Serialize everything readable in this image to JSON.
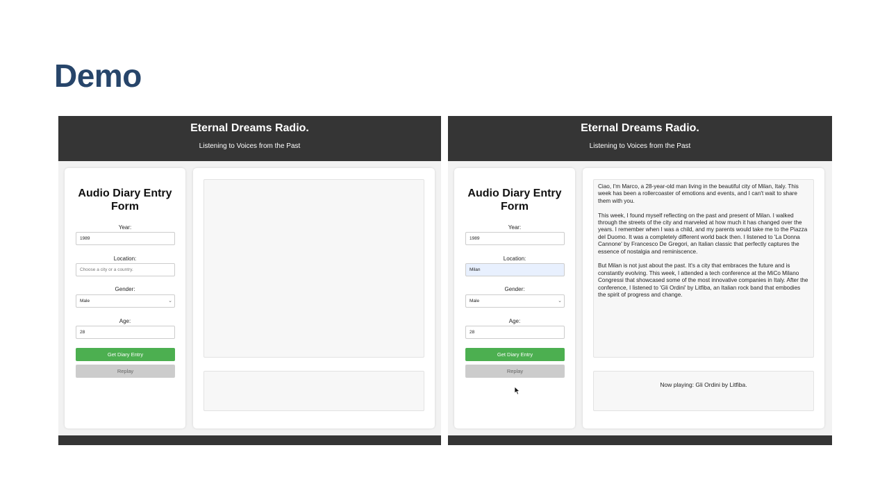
{
  "slide": {
    "title": "Demo"
  },
  "app": {
    "title": "Eternal Dreams Radio.",
    "subtitle": "Listening to Voices from the Past",
    "form_title": "Audio Diary Entry Form",
    "labels": {
      "year": "Year:",
      "location": "Location:",
      "gender": "Gender:",
      "age": "Age:"
    },
    "location_placeholder": "Choose a city or a country.",
    "buttons": {
      "get": "Get Diary Entry",
      "replay": "Replay"
    }
  },
  "left_state": {
    "year": "1989",
    "location": "",
    "gender": "Male",
    "age": "28",
    "diary_text": [],
    "now_playing": ""
  },
  "right_state": {
    "year": "1989",
    "location": "Milan",
    "gender": "Male",
    "age": "28",
    "diary_text": [
      "Ciao, I'm Marco, a 28-year-old man living in the beautiful city of Milan, Italy. This week has been a rollercoaster of emotions and events, and I can't wait to share them with you.",
      "This week, I found myself reflecting on the past and present of Milan. I walked through the streets of the city and marveled at how much it has changed over the years. I remember when I was a child, and my parents would take me to the Piazza del Duomo. It was a completely different world back then. I listened to 'La Donna Cannone' by Francesco De Gregori, an Italian classic that perfectly captures the essence of nostalgia and reminiscence.",
      "But Milan is not just about the past. It's a city that embraces the future and is constantly evolving. This week, I attended a tech conference at the MiCo Milano Congressi that showcased some of the most innovative companies in Italy. After the conference, I listened to 'Gli Ordini' by Litfiba, an Italian rock band that embodies the spirit of progress and change."
    ],
    "now_playing": "Now playing: Gli Ordini by Litfiba."
  },
  "colors": {
    "title": "#27456a",
    "header": "#353535",
    "primary_button": "#4caf50",
    "disabled_button": "#cccccc"
  },
  "icons": {
    "select": "chevron-down-icon",
    "pointer": "mouse-cursor-icon"
  }
}
